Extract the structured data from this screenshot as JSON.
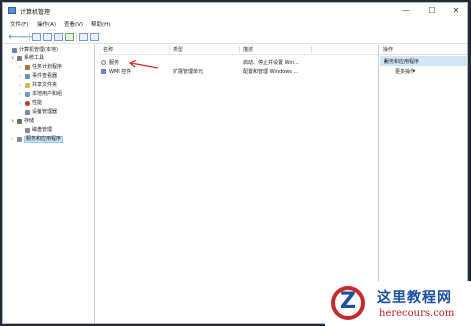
{
  "window": {
    "title": "计算机管理"
  },
  "window_buttons": [
    "—",
    "☐",
    "✕"
  ],
  "menu": [
    "文件(F)",
    "操作(A)",
    "查看(V)",
    "帮助(H)"
  ],
  "toolbar": {
    "back": "🡐",
    "forward": "🡒"
  },
  "tree": [
    {
      "label": "计算机管理(本地)",
      "exp": "",
      "icon_color": "#6b7fa8",
      "level": 0
    },
    {
      "label": "系统工具",
      "exp": "∨",
      "icon_color": "#7a7a7a",
      "level": 1
    },
    {
      "label": "任务计划程序",
      "exp": "›",
      "icon_color": "#b0723a",
      "level": 2
    },
    {
      "label": "事件查看器",
      "exp": "›",
      "icon_color": "#6e8fb8",
      "level": 2
    },
    {
      "label": "共享文件夹",
      "exp": "›",
      "icon_color": "#d9b84a",
      "level": 2
    },
    {
      "label": "本地用户和组",
      "exp": "›",
      "icon_color": "#6a9fd0",
      "level": 2
    },
    {
      "label": "性能",
      "exp": "›",
      "icon_color": "#c0392b",
      "level": 2
    },
    {
      "label": "设备管理器",
      "exp": "",
      "icon_color": "#7a8a9a",
      "level": 2
    },
    {
      "label": "存储",
      "exp": "∨",
      "icon_color": "#5a7a5a",
      "level": 1
    },
    {
      "label": "磁盘管理",
      "exp": "",
      "icon_color": "#8a8a8a",
      "level": 2
    },
    {
      "label": "服务和应用程序",
      "exp": "›",
      "icon_color": "#8a8a8a",
      "level": 1,
      "selected": true
    }
  ],
  "list": {
    "columns": [
      "名称",
      "类型",
      "描述"
    ],
    "rows": [
      {
        "name": "服务",
        "type": "",
        "desc": "启动、停止并设置 Win..."
      },
      {
        "name": "WMI 控件",
        "type": "扩展管理单元",
        "desc": "配置和管理 Windows ..."
      }
    ]
  },
  "actions": {
    "header": "操作",
    "section": "服务和应用程序",
    "more": "更多操作"
  },
  "watermark": {
    "title": "这里教程网",
    "url": "herecours.com"
  }
}
